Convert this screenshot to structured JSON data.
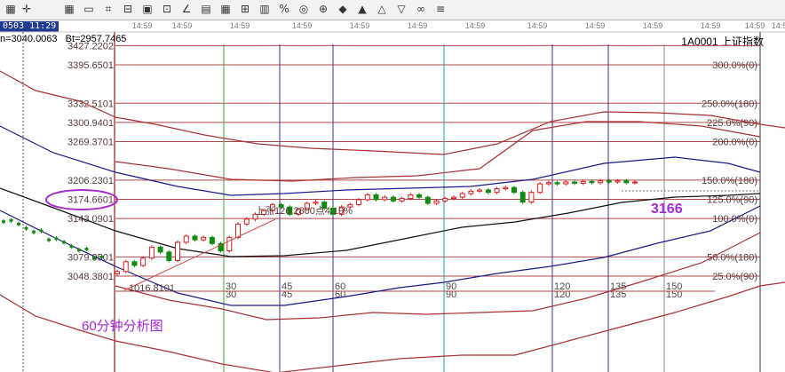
{
  "toolbar": {
    "left_icons": [
      "grid-icon",
      "crosshair-icon"
    ],
    "icons": [
      "toolbar-icon-1",
      "toolbar-icon-2",
      "toolbar-icon-3",
      "toolbar-icon-4",
      "toolbar-icon-5",
      "toolbar-icon-6",
      "toolbar-icon-7",
      "toolbar-icon-8",
      "toolbar-icon-9",
      "toolbar-icon-10",
      "toolbar-icon-11",
      "toolbar-icon-12",
      "toolbar-icon-13",
      "toolbar-icon-14",
      "toolbar-icon-15",
      "toolbar-icon-16",
      "toolbar-icon-17",
      "toolbar-icon-18",
      "toolbar-icon-19",
      "toolbar-icon-20"
    ]
  },
  "header": {
    "datetime": "0503 11:29",
    "ticker_1": "n=3040.0063",
    "ticker_2": "Bt=2957.7465",
    "code": "1A0001",
    "name": "上证指数",
    "time_ticks": [
      "14:59",
      "14:59",
      "14:59",
      "14:59",
      "14:59",
      "14:59",
      "14:59",
      "14:59",
      "14:59",
      "14:59",
      "14:59",
      "14:59",
      "14:59"
    ]
  },
  "chart_data": {
    "type": "candlestick",
    "title": "60分钟分析图",
    "annotation_rise": "上涨126.2800点4.19%",
    "annotation_low": "1016.8101",
    "annotation_target": "3166",
    "circled_level": "3174.6601",
    "price_levels": [
      {
        "price": "3427.2202",
        "pct": ""
      },
      {
        "price": "3395.6501",
        "pct": "300.0%(0)"
      },
      {
        "price": "3332.5101",
        "pct": "250.0%(180)"
      },
      {
        "price": "3300.9401",
        "pct": "225.0%(90)"
      },
      {
        "price": "3269.3701",
        "pct": "200.0%(0)"
      },
      {
        "price": "3206.2301",
        "pct": "150.0%(180)"
      },
      {
        "price": "3174.6601",
        "pct": "125.0%(90)"
      },
      {
        "price": "3143.0901",
        "pct": "100.0%(0)"
      },
      {
        "price": "3079.9501",
        "pct": "50.0%(180)"
      },
      {
        "price": "3048.3801",
        "pct": "25.0%(90)"
      }
    ],
    "cycle_labels": [
      "30",
      "45",
      "60",
      "90",
      "120",
      "135",
      "150"
    ],
    "colors": {
      "up": "#d42020",
      "down": "#128a12",
      "band": "#a83232",
      "mid": "#1a1a8a",
      "accent": "#a82ad1"
    }
  }
}
